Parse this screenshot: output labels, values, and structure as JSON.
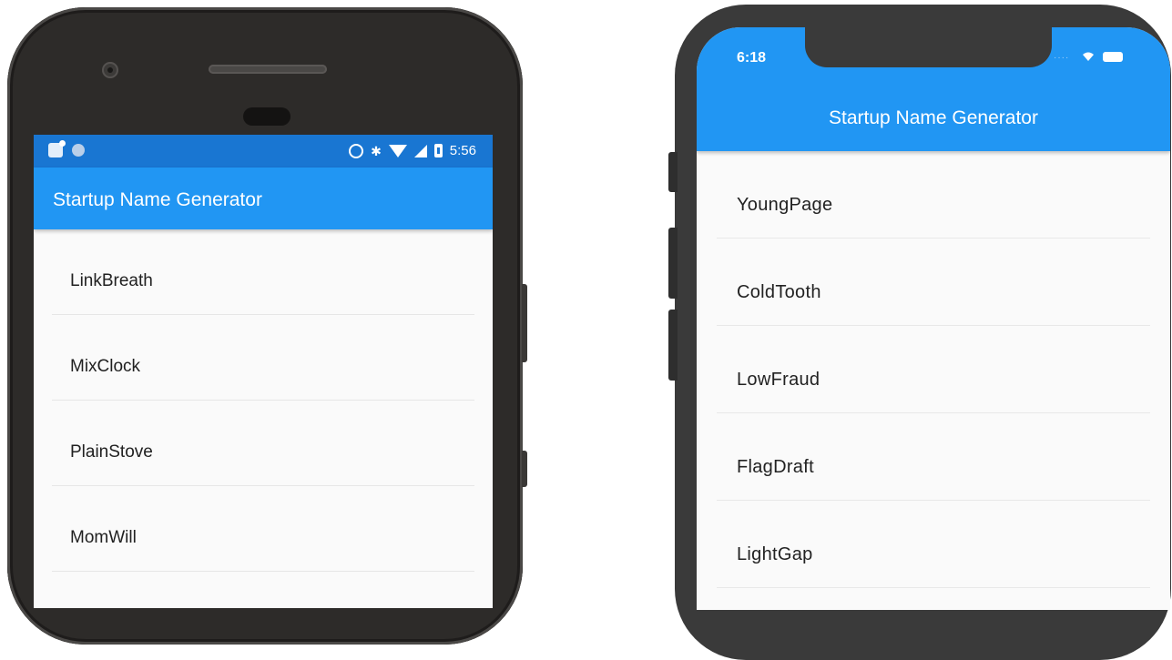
{
  "android": {
    "status_time": "5:56",
    "app_title": "Startup Name Generator",
    "items": [
      "LinkBreath",
      "MixClock",
      "PlainStove",
      "MomWill"
    ]
  },
  "ios": {
    "status_time": "6:18",
    "app_title": "Startup Name Generator",
    "items": [
      "YoungPage",
      "ColdTooth",
      "LowFraud",
      "FlagDraft",
      "LightGap"
    ]
  },
  "colors": {
    "appbar": "#2196f3",
    "android_statusbar": "#1976d2",
    "list_background": "#fafafa"
  },
  "icons": [
    "notification-icon",
    "sync-icon",
    "bluetooth-icon",
    "wifi-icon",
    "signal-icon",
    "battery-icon"
  ]
}
